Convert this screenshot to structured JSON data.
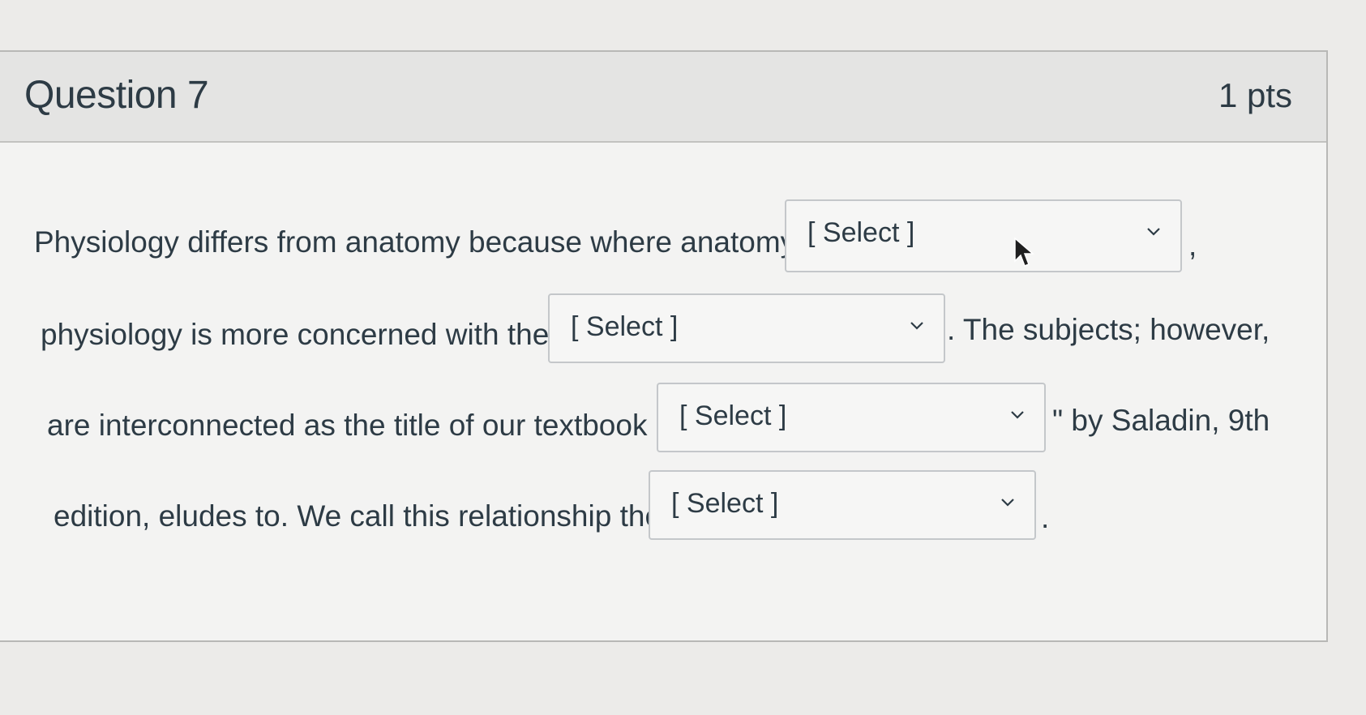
{
  "question": {
    "title": "Question 7",
    "points": "1 pts"
  },
  "text": {
    "line1": "Physiology differs from anatomy because where anatomy",
    "line1_end": ",",
    "line2": "physiology is more concerned with the",
    "line2_end": ". The subjects; however,",
    "line3": "are interconnected as the title of our textbook \"",
    "line3_end": "\" by Saladin, 9th",
    "line4": "edition, eludes to. We call this relationship the",
    "line4_end": "."
  },
  "dropdowns": [
    {
      "value": "[ Select ]"
    },
    {
      "value": "[ Select ]"
    },
    {
      "value": "[ Select ]"
    },
    {
      "value": "[ Select ]"
    }
  ],
  "icons": {
    "dropdown": "chevron-down-icon",
    "cursor": "mouse-pointer-icon"
  },
  "colors": {
    "text": "#2d3b45",
    "header_bg": "#e4e4e3",
    "select_border": "#c4c7ca"
  }
}
